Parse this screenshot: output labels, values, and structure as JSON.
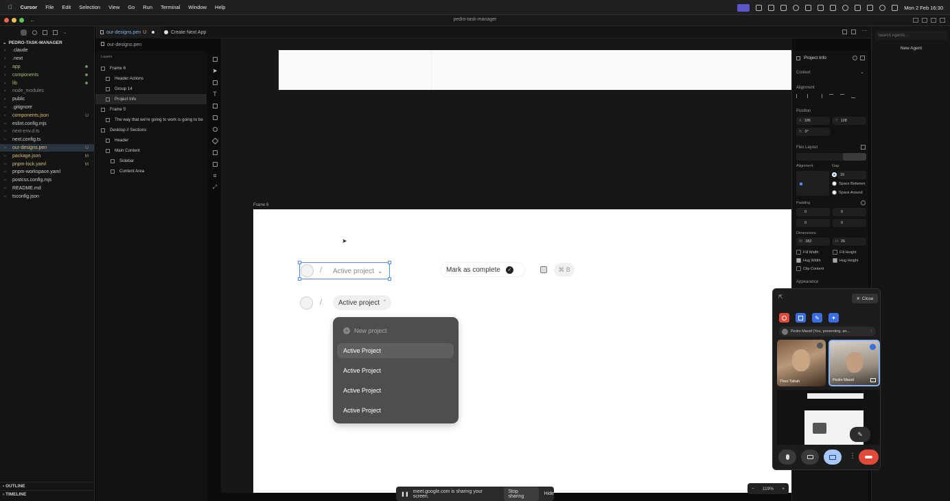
{
  "menubar": {
    "app": "Cursor",
    "items": [
      "File",
      "Edit",
      "Selection",
      "View",
      "Go",
      "Run",
      "Terminal",
      "Window",
      "Help"
    ],
    "clock": "Mon 2 Feb  16:30"
  },
  "window": {
    "title": "pedro-task-manager"
  },
  "explorer": {
    "root": "PEDRO-TASK-MANAGER",
    "items": [
      {
        "name": ".claude",
        "color": "#d0d0d0"
      },
      {
        "name": ".next",
        "color": "#d0d0d0"
      },
      {
        "name": "app",
        "color": "#a6c46d"
      },
      {
        "name": "components",
        "color": "#a6c46d"
      },
      {
        "name": "lib",
        "color": "#a6c46d"
      },
      {
        "name": "node_modules",
        "color": "#8a8a8a"
      },
      {
        "name": "public",
        "color": "#d0d0d0"
      },
      {
        "name": ".gitignore",
        "color": "#d0d0d0"
      },
      {
        "name": "components.json",
        "color": "#d9c27a"
      },
      {
        "name": "eslint.config.mjs",
        "color": "#d0d0d0"
      },
      {
        "name": "next-env.d.ts",
        "color": "#8a8a8a"
      },
      {
        "name": "next.config.ts",
        "color": "#d0d0d0"
      },
      {
        "name": "our-designs.pen",
        "color": "#d9c27a"
      },
      {
        "name": "package.json",
        "color": "#d9c27a"
      },
      {
        "name": "pnpm-lock.yaml",
        "color": "#d9c27a"
      },
      {
        "name": "pnpm-workspace.yaml",
        "color": "#d0d0d0"
      },
      {
        "name": "postcss.config.mjs",
        "color": "#d0d0d0"
      },
      {
        "name": "README.md",
        "color": "#d0d0d0"
      },
      {
        "name": "tsconfig.json",
        "color": "#d0d0d0"
      }
    ],
    "badges": {
      "components.json": "U",
      "our-designs.pen": "U",
      "package.json": "M",
      "pnpm-lock.yaml": "M"
    },
    "outline": "OUTLINE",
    "timeline": "TIMELINE"
  },
  "tabs": {
    "active": "our-designs.pen",
    "active_badge": "U",
    "second": "Create Next App",
    "breadcrumb": "our-designs.pen"
  },
  "layers": {
    "title": "Layers",
    "rows": [
      {
        "label": "Frame 6",
        "indent": 0
      },
      {
        "label": "Header Actions",
        "indent": 1
      },
      {
        "label": "Group 14",
        "indent": 1
      },
      {
        "label": "Project Info",
        "indent": 1
      },
      {
        "label": "Frame 5",
        "indent": 0
      },
      {
        "label": "The way that we're going to work is going to be",
        "indent": 1
      },
      {
        "label": "Desktop // Sections",
        "indent": 0
      },
      {
        "label": "Header",
        "indent": 1
      },
      {
        "label": "Main Content",
        "indent": 1
      },
      {
        "label": "Sidebar",
        "indent": 2
      },
      {
        "label": "Content Area",
        "indent": 2
      }
    ]
  },
  "canvas": {
    "frame_label": "Frame 6",
    "breadcrumb_text": "Active project",
    "mark_complete": "Mark as complete",
    "shortcut": "⌘ B",
    "project_button": "Active project",
    "dropdown": {
      "new_project": "New project",
      "options": [
        "Active Project",
        "Active Project",
        "Active Project",
        "Active Project"
      ]
    },
    "zoom": "119%"
  },
  "props": {
    "title": "Project Info",
    "context": "Context",
    "alignment": "Alignment",
    "position": "Position",
    "x": "186",
    "y": "128",
    "rotation": "0°",
    "flex_layout": "Flex Layout",
    "alignment2": "Alignment",
    "gap": "Gap",
    "gap_value": "16",
    "space_between": "Space Between",
    "space_around": "Space Around",
    "padding": "Padding",
    "pad": [
      "0",
      "0",
      "0",
      "0"
    ],
    "dimensions": "Dimensions",
    "w": "282",
    "h": "26",
    "fill_width": "Fill Width",
    "fill_height": "Fill Height",
    "hug_width": "Hug Width",
    "hug_height": "Hug Height",
    "clip_content": "Clip Content",
    "appearance": "Appearance"
  },
  "agents": {
    "search_placeholder": "Search Agents...",
    "new_agent": "New Agent"
  },
  "meet": {
    "close": "Close",
    "presenter": "Pedro Masid (You, presenting, an...",
    "tile1": "Theo Tabah",
    "tile2": "Pedro Masid"
  },
  "share": {
    "text": "meet.google.com is sharing your screen.",
    "stop": "Stop sharing",
    "hide": "Hide"
  }
}
